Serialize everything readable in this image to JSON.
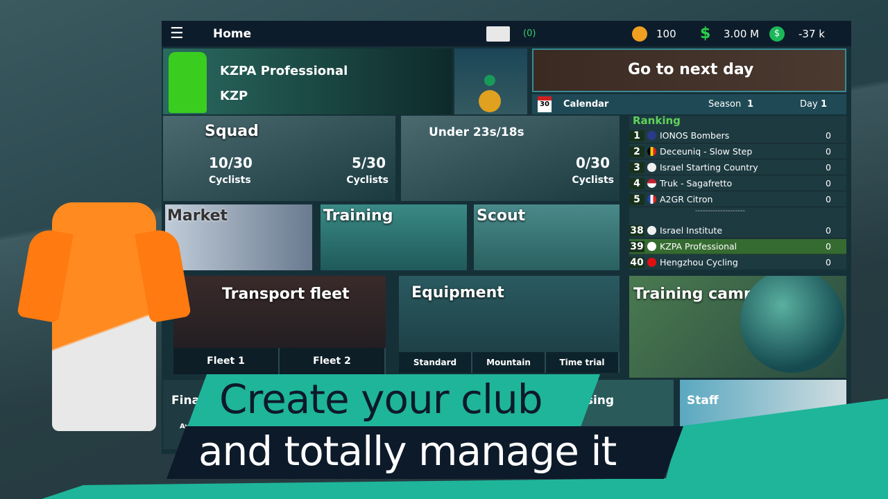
{
  "topbar": {
    "title": "Home",
    "mail_count": "(0)",
    "coins": "100",
    "money": "3.00 M",
    "balance": "-37 k"
  },
  "team": {
    "name": "KZPA Professional",
    "short": "KZP"
  },
  "next_day": "Go to next day",
  "calendar": {
    "label": "Calendar",
    "date_icon": "30",
    "season_label": "Season",
    "season": "1",
    "day_label": "Day",
    "day": "1"
  },
  "squad": {
    "title": "Squad",
    "count1": "10/30",
    "label1": "Cyclists",
    "count2": "5/30",
    "label2": "Cyclists"
  },
  "under": {
    "title": "Under 23s/18s",
    "count": "0/30",
    "label": "Cyclists"
  },
  "ranking": {
    "title": "Ranking",
    "separator": "--------------------",
    "rows": [
      {
        "pos": "1",
        "flag": "uk",
        "name": "IONOS Bombers",
        "pts": "0"
      },
      {
        "pos": "2",
        "flag": "belgium",
        "name": "Deceuniq - Slow Step",
        "pts": "0"
      },
      {
        "pos": "3",
        "flag": "israel",
        "name": "Israel Starting Country",
        "pts": "0"
      },
      {
        "pos": "4",
        "flag": "usa",
        "name": "Truk - Sagafretto",
        "pts": "0"
      },
      {
        "pos": "5",
        "flag": "france",
        "name": "A2GR Citron",
        "pts": "0"
      },
      {
        "pos": "38",
        "flag": "israel",
        "name": "Israel Institute",
        "pts": "0"
      },
      {
        "pos": "39",
        "flag": "korea",
        "name": "KZPA Professional",
        "pts": "0"
      },
      {
        "pos": "40",
        "flag": "china",
        "name": "Hengzhou Cycling",
        "pts": "0"
      }
    ]
  },
  "tiles": {
    "market": "Market",
    "training": "Training",
    "scout": "Scout",
    "transport": "Transport fleet",
    "fleet1": "Fleet 1",
    "fleet2": "Fleet 2",
    "equipment": "Equipment",
    "standard": "Standard",
    "mountain": "Mountain",
    "time_trial": "Time trial",
    "camp": "Training camp",
    "finances": "Fina",
    "finances_sub": "Av",
    "advertising": "ising",
    "staff": "Staff"
  },
  "banner": {
    "line1": "Create your club",
    "line2": "and totally manage it"
  },
  "colors": {
    "accent": "#1fb59a",
    "navy": "#0d1a2a",
    "green": "#5fd35a",
    "jersey": "#ff7a10"
  }
}
